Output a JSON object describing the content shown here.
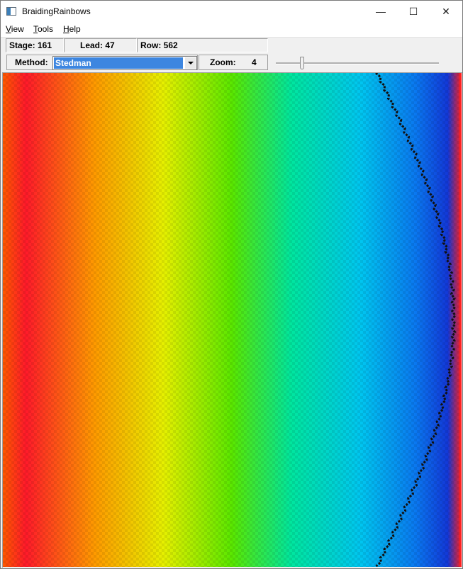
{
  "window": {
    "title": "BraidingRainbows",
    "minimize_glyph": "—",
    "maximize_glyph": "☐",
    "close_glyph": "✕"
  },
  "menu": [
    {
      "accel": "V",
      "rest": "iew"
    },
    {
      "accel": "T",
      "rest": "ools"
    },
    {
      "accel": "H",
      "rest": "elp"
    }
  ],
  "status": {
    "stage": "Stage: 161",
    "lead": "Lead: 47",
    "row": "Row: 562"
  },
  "toolbar": {
    "method_label": "Method:",
    "method_value": "Stedman",
    "zoom_label": "Zoom:",
    "zoom_value": "4",
    "zoom_slider_fraction": 0.16
  },
  "canvas": {
    "icons": {
      "combo_arrow": "chevron-down-icon"
    }
  }
}
